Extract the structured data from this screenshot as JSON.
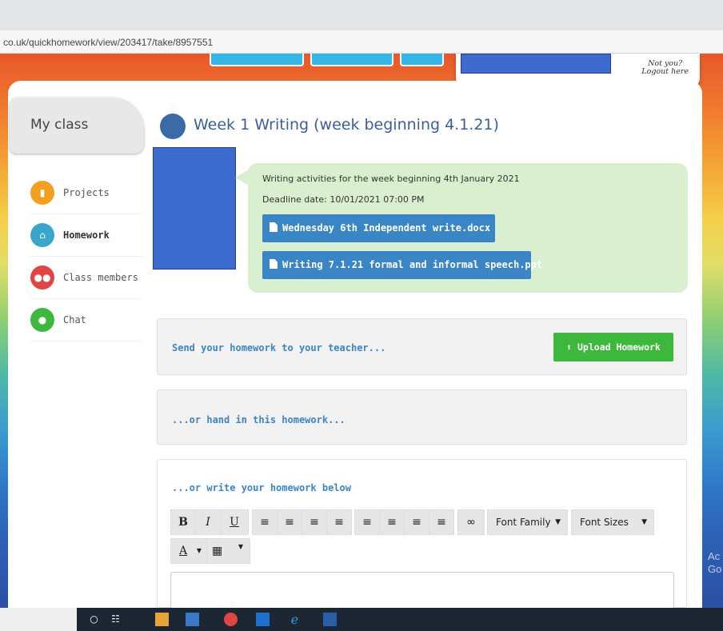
{
  "browser": {
    "url": "co.uk/quickhomework/view/203417/take/8957551"
  },
  "header": {
    "not_you": "Not you?",
    "logout": "Logout here"
  },
  "sidebar": {
    "title": "My class",
    "items": [
      {
        "label": "Projects",
        "icon": "book-icon",
        "color": "#f3a020"
      },
      {
        "label": "Homework",
        "icon": "home-icon",
        "color": "#3aa6cc",
        "active": true
      },
      {
        "label": "Class members",
        "icon": "users-icon",
        "color": "#e04545"
      },
      {
        "label": "Chat",
        "icon": "chat-icon",
        "color": "#3db83d"
      }
    ]
  },
  "homework": {
    "title": "Week 1 Writing (week beginning 4.1.21)",
    "description": "Writing activities for the week beginning 4th January 2021",
    "deadline": "Deadline date: 10/01/2021 07:00 PM",
    "files": [
      "Wednesday 6th Independent write.docx",
      "Writing 7.1.21 formal and informal speech.ppt"
    ]
  },
  "send": {
    "label": "Send your homework to your teacher...",
    "button": "Upload Homework"
  },
  "handin": {
    "label": "...or hand in this homework..."
  },
  "editor": {
    "label": "...or write your homework below",
    "toolbar": {
      "bold": "B",
      "italic": "I",
      "underline": "U",
      "font_family": "Font Family",
      "font_sizes": "Font Sizes",
      "text_color": "A"
    }
  },
  "watermark": {
    "line1": "Ac",
    "line2": "Go"
  },
  "colors": {
    "accent": "#3a85c6",
    "upload": "#3db83d",
    "bubble": "#d9efcf"
  }
}
